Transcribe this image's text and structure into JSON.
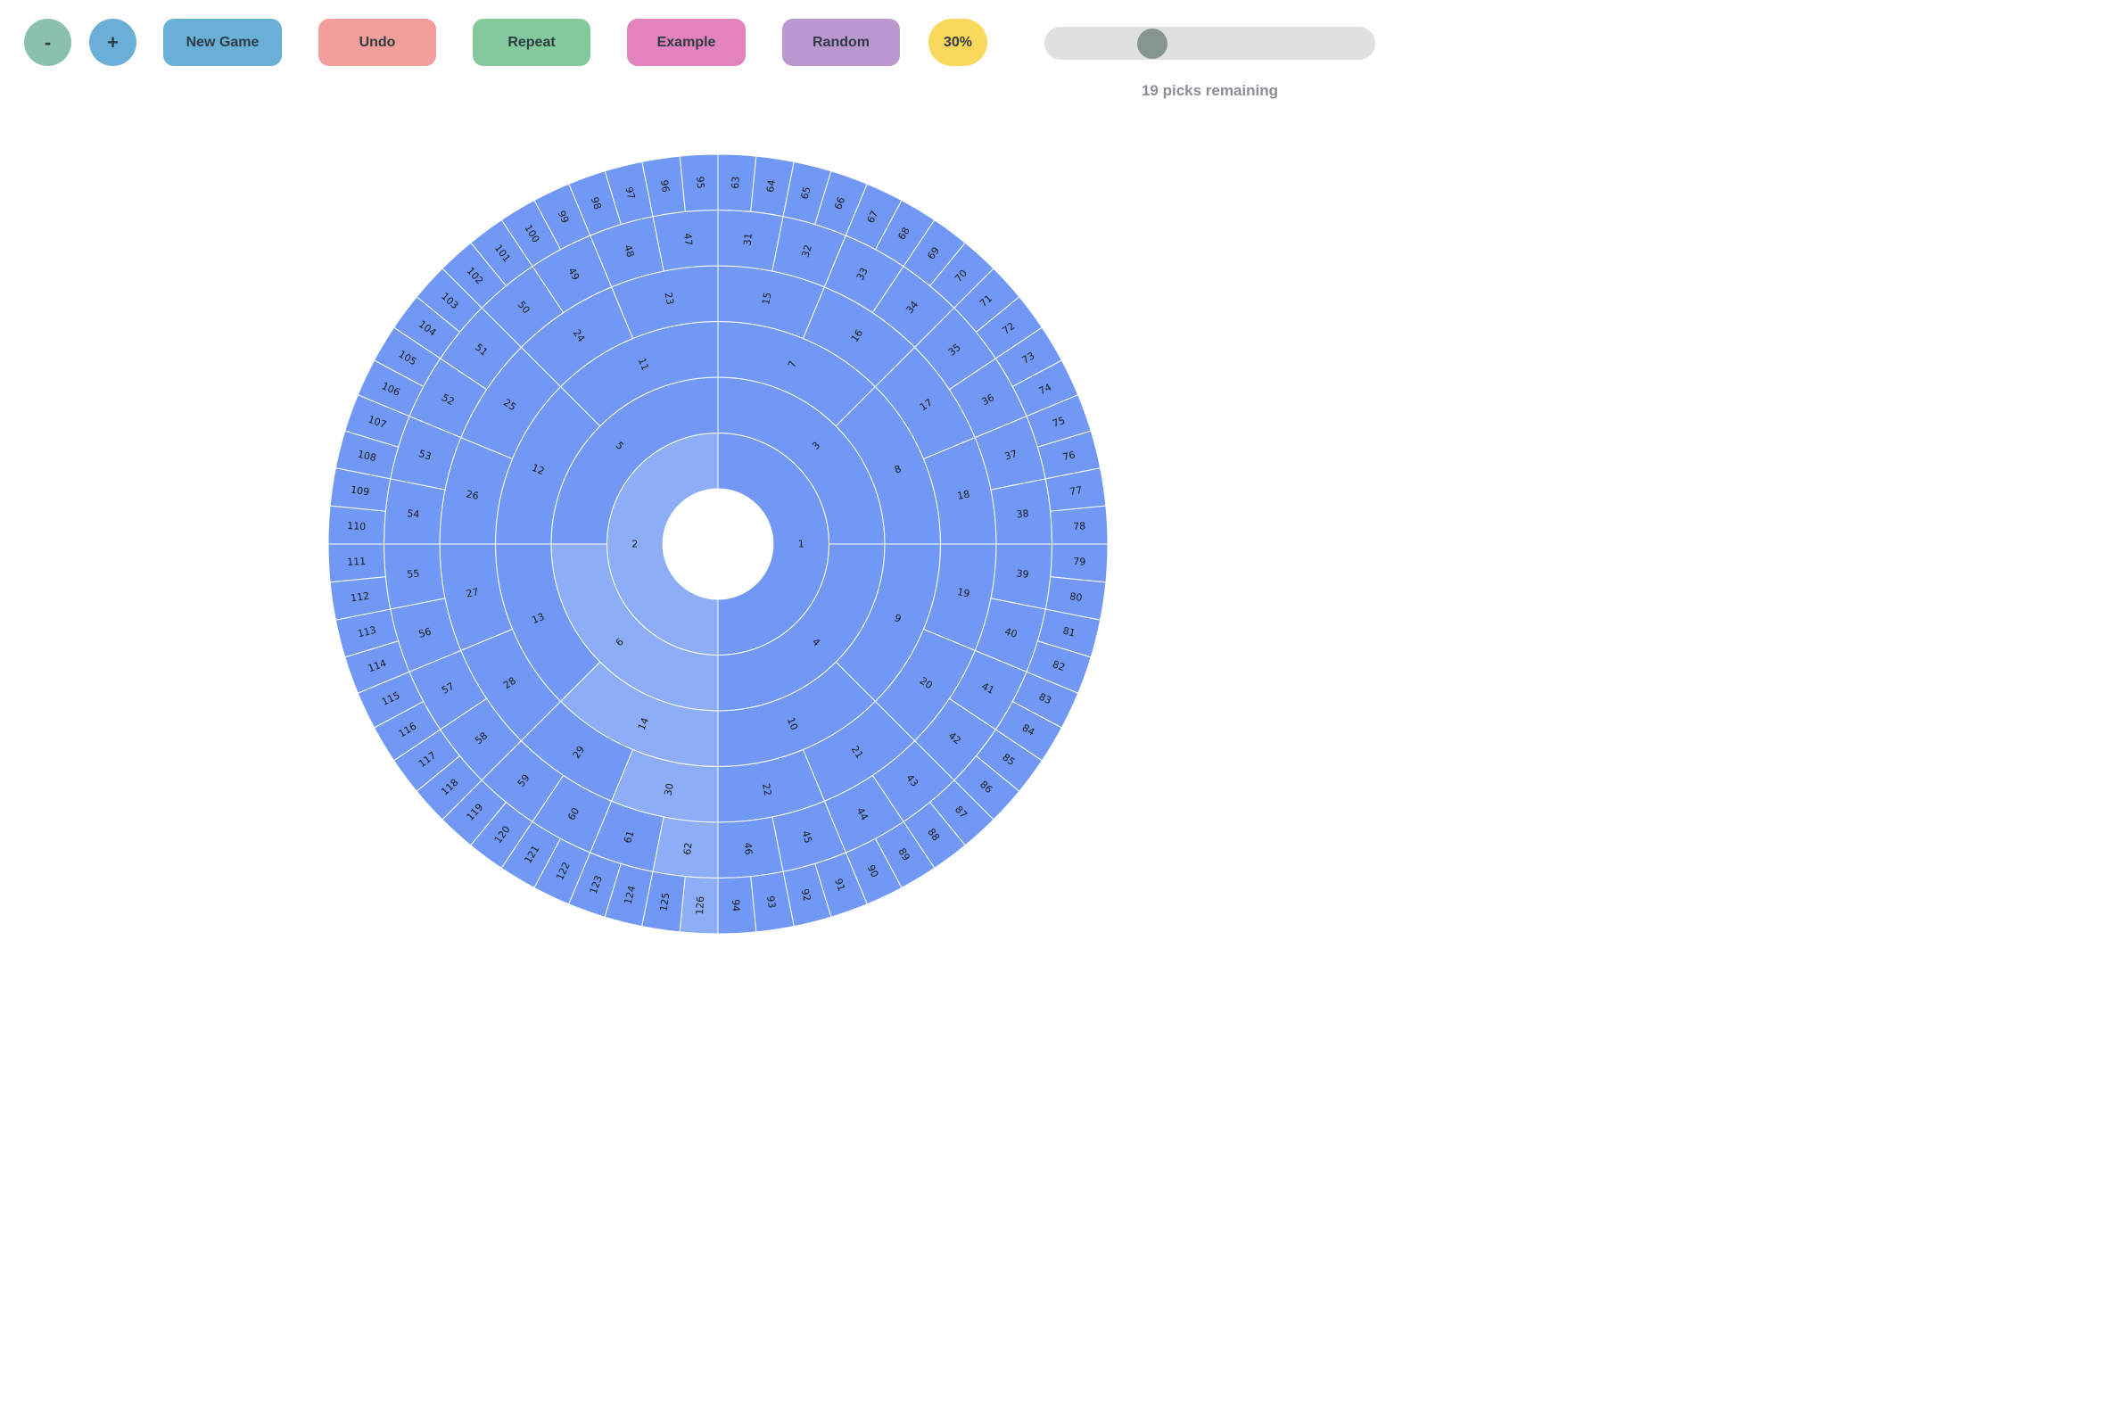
{
  "toolbar": {
    "minus_label": "-",
    "plus_label": "+",
    "new_game_label": "New Game",
    "undo_label": "Undo",
    "repeat_label": "Repeat",
    "example_label": "Example",
    "random_label": "Random",
    "percent_label": "30%"
  },
  "colors": {
    "minus": "#8bbfae",
    "plus": "#6ab0d6",
    "new_game": "#6ab0d6",
    "undo": "#f29e9a",
    "repeat": "#82c99b",
    "example": "#e283bd",
    "random": "#bb97cf",
    "percent": "#f9d85c",
    "segment": "#7198f5",
    "segment_selected": "#8dadf7",
    "segment_stroke": "#ffffff"
  },
  "slider": {
    "value_fraction": 0.31
  },
  "status": {
    "picks_remaining": "19 picks remaining"
  },
  "board": {
    "rings": 6,
    "selected_nodes": [
      2,
      6,
      14,
      30,
      62,
      126
    ]
  }
}
